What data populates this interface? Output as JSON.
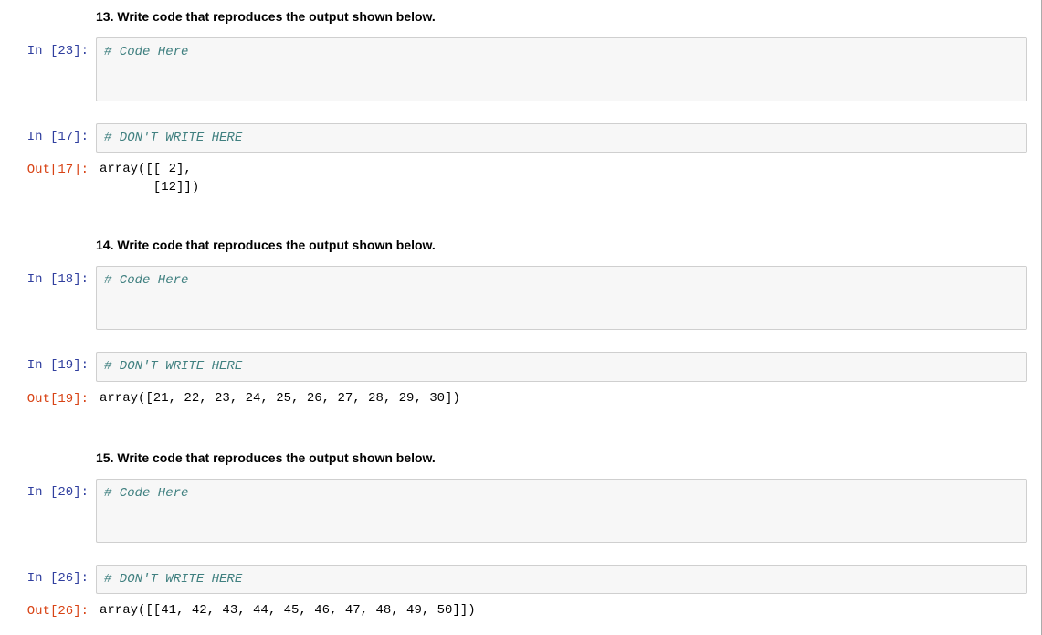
{
  "sections": [
    {
      "title": "13. Write code that reproduces the output shown below.",
      "code_prompt": "In [23]:",
      "code_text": "# Code Here",
      "result_in_prompt": "In [17]:",
      "result_in_text": "# DON'T WRITE HERE",
      "result_out_prompt": "Out[17]:",
      "result_out_text": "array([[ 2],\n       [12]])"
    },
    {
      "title": "14. Write code that reproduces the output shown below.",
      "code_prompt": "In [18]:",
      "code_text": "# Code Here",
      "result_in_prompt": "In [19]:",
      "result_in_text": "# DON'T WRITE HERE",
      "result_out_prompt": "Out[19]:",
      "result_out_text": "array([21, 22, 23, 24, 25, 26, 27, 28, 29, 30])"
    },
    {
      "title": "15. Write code that reproduces the output shown below.",
      "code_prompt": "In [20]:",
      "code_text": "# Code Here",
      "result_in_prompt": "In [26]:",
      "result_in_text": "# DON'T WRITE HERE",
      "result_out_prompt": "Out[26]:",
      "result_out_text": "array([[41, 42, 43, 44, 45, 46, 47, 48, 49, 50]])"
    }
  ]
}
